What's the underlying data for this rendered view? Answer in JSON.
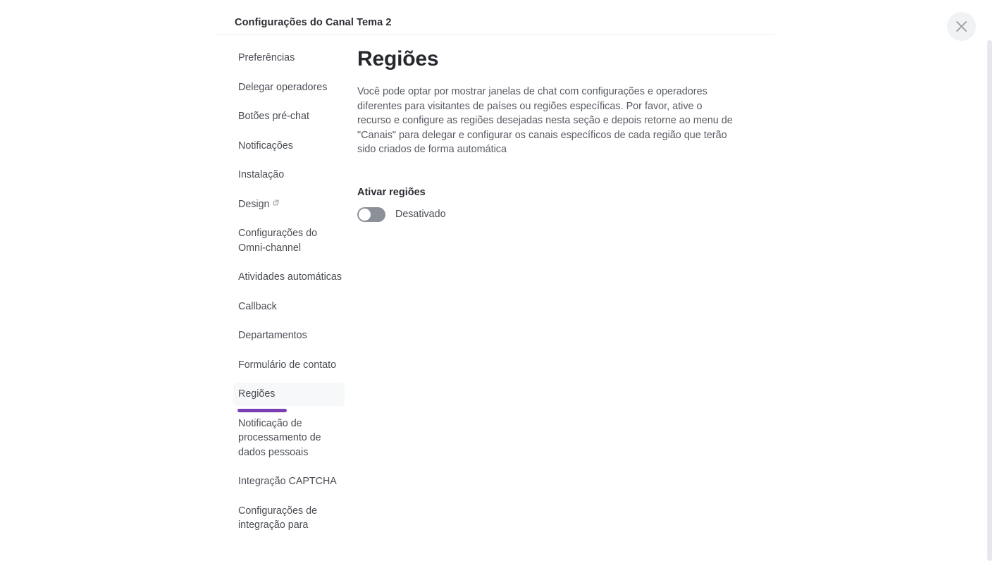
{
  "window": {
    "title": "Configurações do Canal Tema 2",
    "close_icon": "close-icon"
  },
  "sidebar": {
    "items": [
      {
        "label": "Preferências",
        "active": false,
        "external": false
      },
      {
        "label": "Delegar operadores",
        "active": false,
        "external": false
      },
      {
        "label": "Botões pré-chat",
        "active": false,
        "external": false
      },
      {
        "label": "Notificações",
        "active": false,
        "external": false
      },
      {
        "label": "Instalação",
        "active": false,
        "external": false
      },
      {
        "label": "Design",
        "active": false,
        "external": true
      },
      {
        "label": "Configurações do Omni-channel",
        "active": false,
        "external": false
      },
      {
        "label": "Atividades automáticas",
        "active": false,
        "external": false
      },
      {
        "label": "Callback",
        "active": false,
        "external": false
      },
      {
        "label": "Departamentos",
        "active": false,
        "external": false
      },
      {
        "label": "Formulário de contato",
        "active": false,
        "external": false
      },
      {
        "label": "Regiões",
        "active": true,
        "external": false
      },
      {
        "label": "Notificação de processamento de dados pessoais",
        "active": false,
        "external": false
      },
      {
        "label": "Integração CAPTCHA",
        "active": false,
        "external": false
      },
      {
        "label": "Configurações de integração para",
        "active": false,
        "external": false
      }
    ]
  },
  "main": {
    "title": "Regiões",
    "description": "Você pode optar por mostrar janelas de chat com configurações e operadores diferentes para visitantes de países ou regiões específicas. Por favor, ative o recurso e configure as regiões desejadas nesta seção e depois retorne ao menu de \"Canais\" para delegar e configurar os canais específicos de cada região que terão sido criados de forma automática",
    "enable_section": {
      "heading": "Ativar regiões",
      "toggle_state_label": "Desativado",
      "toggle_on": false
    }
  },
  "colors": {
    "accent_purple": "#7b3fb5",
    "toggle_off": "#8c9199",
    "active_item_bg": "#f7f8f9"
  }
}
